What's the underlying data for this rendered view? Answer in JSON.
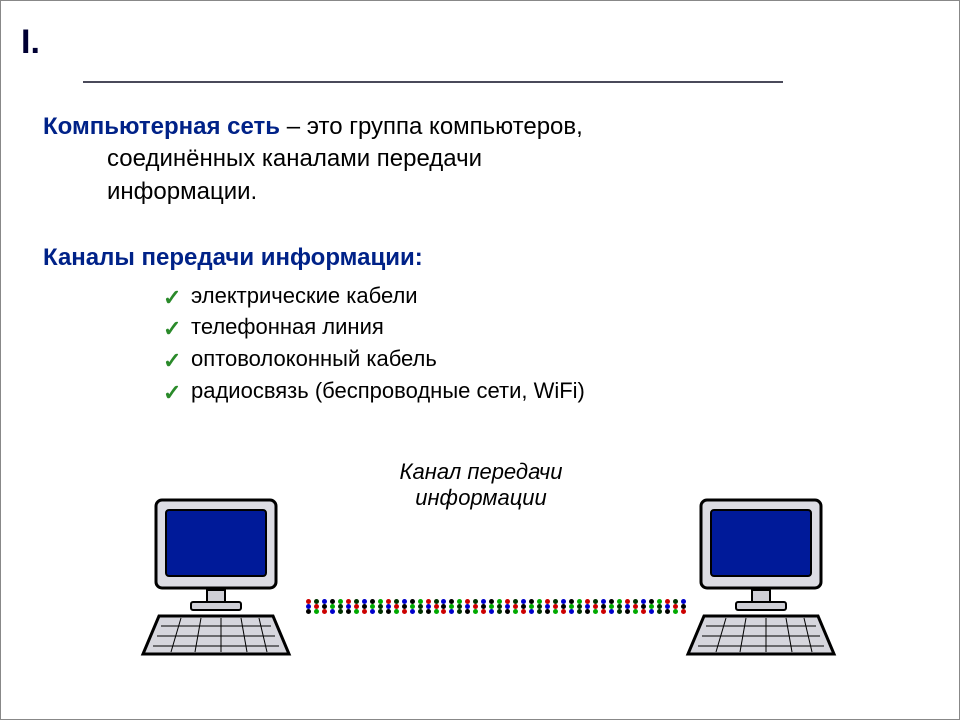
{
  "section_number": "I.",
  "definition": {
    "term": "Компьютерная сеть",
    "rest_firstline": " – это группа компьютеров,",
    "cont_line1": "соединённых каналами передачи",
    "cont_line2": "информации."
  },
  "channels": {
    "heading": "Каналы передачи информации:",
    "items": [
      "электрические кабели",
      "телефонная линия",
      "оптоволоконный кабель",
      "радиосвязь (беспроводные сети, WiFi)"
    ]
  },
  "diagram": {
    "caption_line1": "Канал передачи",
    "caption_line2": "информации"
  },
  "colors": {
    "accent": "#002288",
    "check": "#2a8a2a"
  }
}
